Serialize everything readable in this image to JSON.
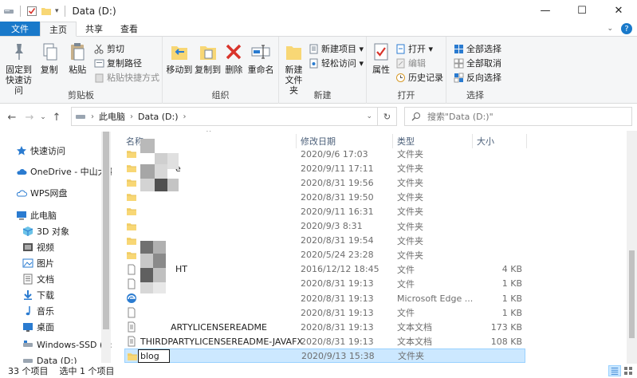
{
  "window": {
    "title": "Data (D:)",
    "controls": [
      "—",
      "☐",
      "✕"
    ]
  },
  "tabs": {
    "file": "文件",
    "home": "主页",
    "share": "共享",
    "view": "查看"
  },
  "ribbon": {
    "clipboard": {
      "label": "剪贴板",
      "pin": "固定到\n快速访问",
      "copy": "复制",
      "paste": "粘贴",
      "cut": "剪切",
      "copy_path": "复制路径",
      "paste_shortcut": "粘贴快捷方式"
    },
    "organize": {
      "label": "组织",
      "move_to": "移动到",
      "copy_to": "复制到",
      "delete": "删除",
      "rename": "重命名"
    },
    "new": {
      "label": "新建",
      "new_folder": "新建\n文件夹",
      "new_item": "新建项目 ▾",
      "easy_access": "轻松访问 ▾"
    },
    "open": {
      "label": "打开",
      "properties": "属性",
      "open": "打开 ▾",
      "edit": "编辑",
      "history": "历史记录"
    },
    "select": {
      "label": "选择",
      "select_all": "全部选择",
      "select_none": "全部取消",
      "invert": "反向选择"
    }
  },
  "address": {
    "pc": "此电脑",
    "drive": "Data (D:)",
    "search_placeholder": "搜索\"Data (D:)\""
  },
  "nav": {
    "items": [
      {
        "label": "快速访问",
        "icon": "star-icon"
      },
      {
        "label": "OneDrive - 中山大学",
        "icon": "cloud-icon"
      },
      {
        "label": "WPS网盘",
        "icon": "cloud-icon"
      },
      {
        "label": "此电脑",
        "icon": "computer-icon"
      },
      {
        "label": "3D 对象",
        "icon": "cube-icon"
      },
      {
        "label": "视频",
        "icon": "video-icon"
      },
      {
        "label": "图片",
        "icon": "picture-icon"
      },
      {
        "label": "文档",
        "icon": "document-icon"
      },
      {
        "label": "下载",
        "icon": "download-icon"
      },
      {
        "label": "音乐",
        "icon": "music-icon"
      },
      {
        "label": "桌面",
        "icon": "desktop-icon"
      },
      {
        "label": "Windows-SSD (C:)",
        "icon": "drive-icon"
      },
      {
        "label": "Data (D:)",
        "icon": "drive-icon"
      }
    ]
  },
  "columns": {
    "name": "名称",
    "date": "修改日期",
    "type": "类型",
    "size": "大小"
  },
  "files": [
    {
      "name": "",
      "date": "2020/9/6 17:03",
      "type": "文件夹",
      "size": "",
      "icon": "folder-icon"
    },
    {
      "name": "e",
      "date": "2020/9/11 17:11",
      "type": "文件夹",
      "size": "",
      "icon": "folder-icon"
    },
    {
      "name": "",
      "date": "2020/8/31 19:56",
      "type": "文件夹",
      "size": "",
      "icon": "folder-icon"
    },
    {
      "name": "",
      "date": "2020/8/31 19:50",
      "type": "文件夹",
      "size": "",
      "icon": "folder-icon"
    },
    {
      "name": "",
      "date": "2020/9/11 16:31",
      "type": "文件夹",
      "size": "",
      "icon": "folder-icon"
    },
    {
      "name": "",
      "date": "2020/9/3 8:31",
      "type": "文件夹",
      "size": "",
      "icon": "folder-icon"
    },
    {
      "name": "",
      "date": "2020/8/31 19:54",
      "type": "文件夹",
      "size": "",
      "icon": "folder-icon"
    },
    {
      "name": "",
      "date": "2020/5/24 23:28",
      "type": "文件夹",
      "size": "",
      "icon": "folder-icon"
    },
    {
      "name": "HT",
      "date": "2016/12/12 18:45",
      "type": "文件",
      "size": "4 KB",
      "icon": "file-icon"
    },
    {
      "name": "",
      "date": "2020/8/31 19:13",
      "type": "文件",
      "size": "1 KB",
      "icon": "file-icon"
    },
    {
      "name": "",
      "date": "2020/8/31 19:13",
      "type": "Microsoft Edge ...",
      "size": "1 KB",
      "icon": "edge-icon"
    },
    {
      "name": "",
      "date": "2020/8/31 19:13",
      "type": "文件",
      "size": "1 KB",
      "icon": "file-icon"
    },
    {
      "name": "ARTYLICENSEREADME",
      "date": "2020/8/31 19:13",
      "type": "文本文档",
      "size": "173 KB",
      "icon": "text-file-icon"
    },
    {
      "name": "THIRDPARTYLICENSEREADME-JAVAFX",
      "date": "2020/8/31 19:13",
      "type": "文本文档",
      "size": "108 KB",
      "icon": "text-file-icon"
    },
    {
      "name": "blog",
      "date": "2020/9/13 15:38",
      "type": "文件夹",
      "size": "",
      "icon": "folder-icon"
    }
  ],
  "status": {
    "count": "33 个项目",
    "selected": "选中 1 个项目"
  },
  "colors": {
    "accent": "#1979ca",
    "selection": "#cce8ff",
    "folder": "#f8d775"
  }
}
